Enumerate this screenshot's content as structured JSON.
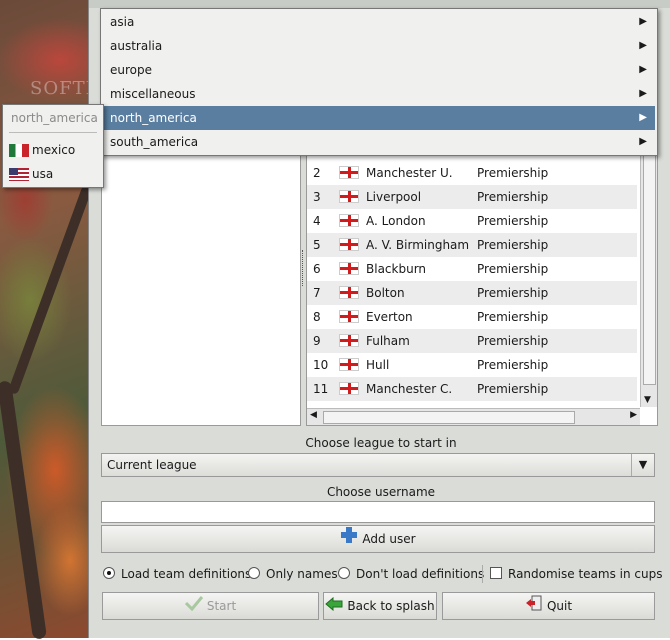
{
  "menu": {
    "items": [
      {
        "label": "asia"
      },
      {
        "label": "australia"
      },
      {
        "label": "europe"
      },
      {
        "label": "miscellaneous"
      },
      {
        "label": "north_america"
      },
      {
        "label": "south_america"
      }
    ],
    "active_index": 4
  },
  "submenu": {
    "title": "north_america",
    "items": [
      {
        "label": "mexico",
        "flag": "mexico-flag-icon"
      },
      {
        "label": "usa",
        "flag": "usa-flag-icon"
      }
    ]
  },
  "watermark": "SOFTPEDIA",
  "table": {
    "rows": [
      {
        "rank": "2",
        "team": "Manchester U.",
        "league": "Premiership"
      },
      {
        "rank": "3",
        "team": "Liverpool",
        "league": "Premiership"
      },
      {
        "rank": "4",
        "team": "A. London",
        "league": "Premiership"
      },
      {
        "rank": "5",
        "team": "A. V. Birmingham",
        "league": "Premiership"
      },
      {
        "rank": "6",
        "team": "Blackburn",
        "league": "Premiership"
      },
      {
        "rank": "7",
        "team": "Bolton",
        "league": "Premiership"
      },
      {
        "rank": "8",
        "team": "Everton",
        "league": "Premiership"
      },
      {
        "rank": "9",
        "team": "Fulham",
        "league": "Premiership"
      },
      {
        "rank": "10",
        "team": "Hull",
        "league": "Premiership"
      },
      {
        "rank": "11",
        "team": "Manchester C.",
        "league": "Premiership"
      }
    ],
    "flag_icon": "england-flag-icon"
  },
  "league": {
    "label": "Choose league to start in",
    "value": "Current league"
  },
  "username": {
    "label": "Choose username",
    "value": ""
  },
  "add_user_label": "Add user",
  "options": {
    "load_defs": "Load team definitions",
    "only_names": "Only names",
    "dont_load": "Don't load definitions",
    "randomise": "Randomise teams in cups",
    "selected": "load_defs",
    "randomise_checked": false
  },
  "buttons": {
    "start": "Start",
    "back": "Back to splash",
    "quit": "Quit"
  },
  "colors": {
    "menu_highlight": "#5a7ea0",
    "window_bg": "#d9dcd7"
  }
}
